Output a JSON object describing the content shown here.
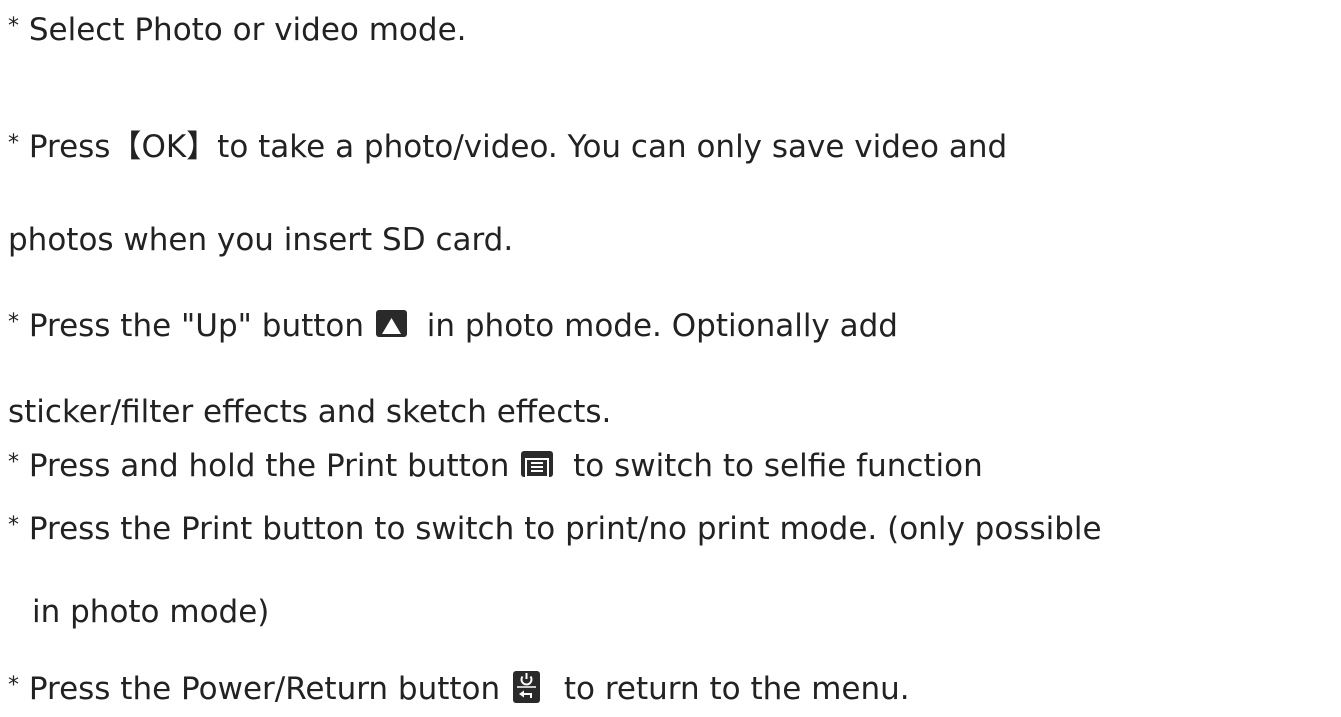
{
  "instructions": {
    "l1": "Select Photo or video mode.",
    "l2": "Press【OK】to take a photo/video. You can only save video and",
    "l3": "photos when you insert SD card.",
    "l4a": "Press the \"Up\" button",
    "l4b": "in photo mode. Optionally add",
    "l5": "sticker/filter effects and sketch effects.",
    "l6a": "Press and hold the Print button",
    "l6b": "to switch to selfie function",
    "l7": "Press the Print button to switch to print/no print mode. (only possible",
    "l8": "in photo mode)",
    "l9a": "Press the Power/Return button",
    "l9b": "to return to the menu.",
    "bullet": "*"
  },
  "icons": {
    "up": "up-arrow-icon",
    "print": "print-icon",
    "power": "power-return-icon"
  },
  "colors": {
    "text": "#222222",
    "icon_bg": "#2a2a2a",
    "icon_fg": "#ffffff"
  }
}
